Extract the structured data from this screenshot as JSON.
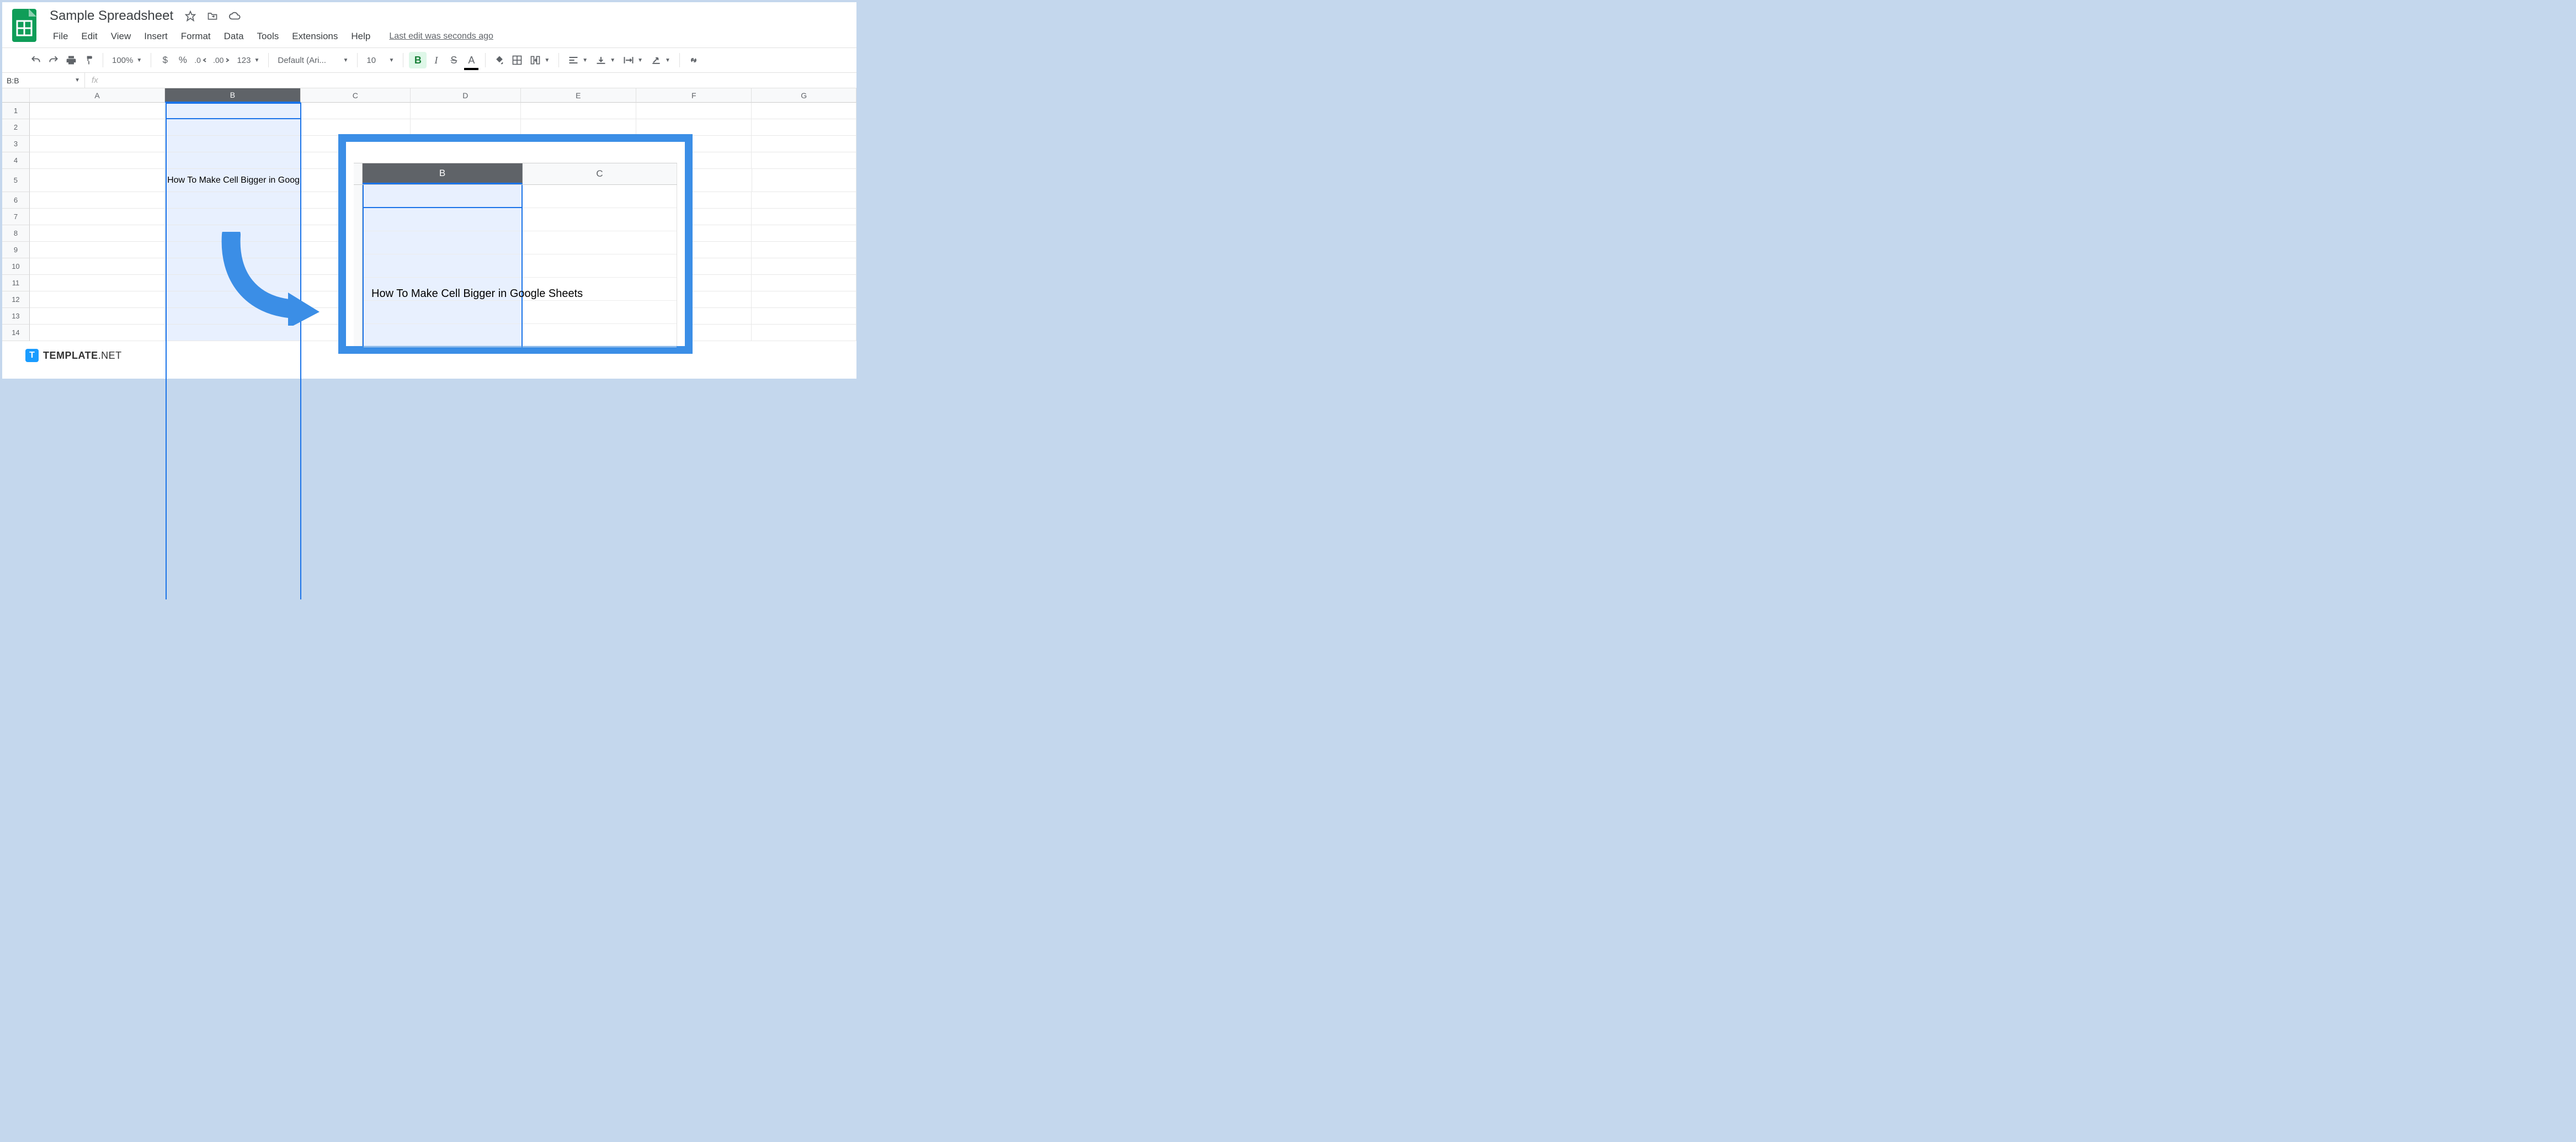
{
  "doc": {
    "title": "Sample Spreadsheet"
  },
  "menus": {
    "file": "File",
    "edit": "Edit",
    "view": "View",
    "insert": "Insert",
    "format": "Format",
    "data": "Data",
    "tools": "Tools",
    "extensions": "Extensions",
    "help": "Help",
    "last_edit": "Last edit was seconds ago"
  },
  "toolbar": {
    "zoom": "100%",
    "currency": "$",
    "percent": "%",
    "dec_dec": ".0",
    "inc_dec": ".00",
    "more_fmt": "123",
    "font": "Default (Ari...",
    "font_size": "10",
    "bold": "B",
    "italic": "I",
    "strike": "S",
    "textcolor": "A"
  },
  "namebox": {
    "ref": "B:B"
  },
  "fx": {
    "label": "fx"
  },
  "columns": {
    "A": "A",
    "B": "B",
    "C": "C",
    "D": "D",
    "E": "E",
    "F": "F",
    "G": "G"
  },
  "rows": [
    "1",
    "2",
    "3",
    "4",
    "5",
    "6",
    "7",
    "8",
    "9",
    "10",
    "11",
    "12",
    "13",
    "14"
  ],
  "cells": {
    "B5": "How To Make Cell Bigger in Goog"
  },
  "callout": {
    "colB": "B",
    "colC": "C",
    "text": "How To Make Cell Bigger in Google Sheets"
  },
  "watermark": {
    "icon": "T",
    "brand": "TEMPLATE",
    "suffix": ".NET"
  }
}
